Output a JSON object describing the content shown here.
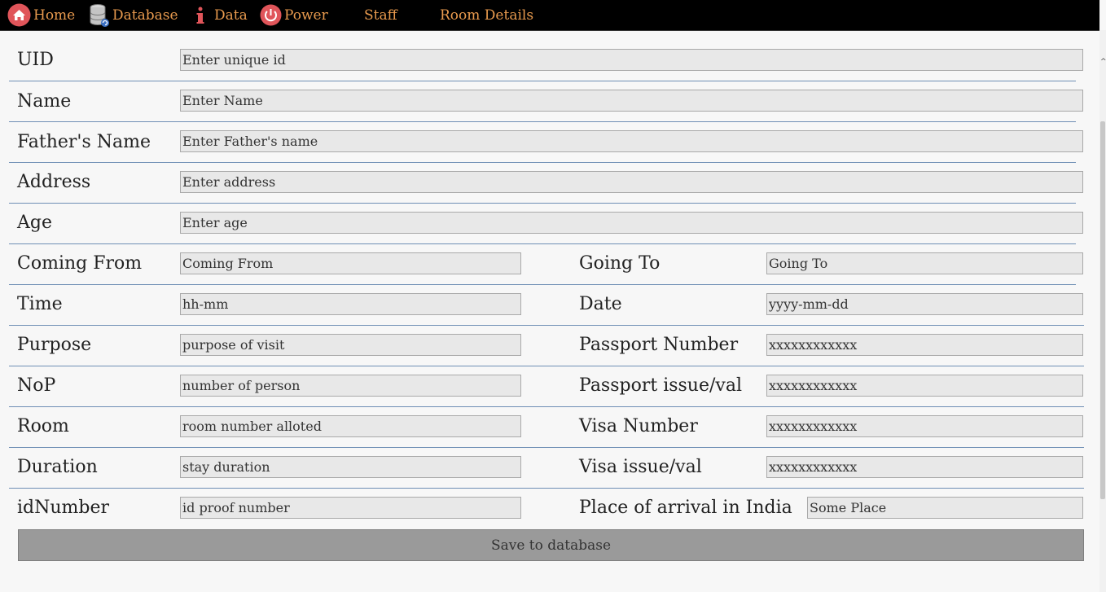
{
  "nav": {
    "home": "Home",
    "database": "Database",
    "data": "Data",
    "power": "Power",
    "staff": "Staff",
    "room_details": "Room Details"
  },
  "form": {
    "uid": {
      "label": "UID",
      "placeholder": "Enter unique id"
    },
    "name": {
      "label": "Name",
      "placeholder": "Enter Name"
    },
    "father_name": {
      "label": "Father's Name",
      "placeholder": "Enter Father's name"
    },
    "address": {
      "label": "Address",
      "placeholder": "Enter address"
    },
    "age": {
      "label": "Age",
      "placeholder": "Enter age"
    },
    "coming_from": {
      "label": "Coming From",
      "placeholder": "Coming From"
    },
    "going_to": {
      "label": "Going To",
      "placeholder": "Going To"
    },
    "time": {
      "label": "Time",
      "placeholder": "hh-mm"
    },
    "date": {
      "label": "Date",
      "placeholder": "yyyy-mm-dd"
    },
    "purpose": {
      "label": "Purpose",
      "placeholder": "purpose of visit"
    },
    "passport_number": {
      "label": "Passport Number",
      "placeholder": "xxxxxxxxxxxx"
    },
    "nop": {
      "label": "NoP",
      "placeholder": "number of person"
    },
    "passport_issue": {
      "label": "Passport issue/val",
      "placeholder": "xxxxxxxxxxxx"
    },
    "room": {
      "label": "Room",
      "placeholder": "room number alloted"
    },
    "visa_number": {
      "label": "Visa Number",
      "placeholder": "xxxxxxxxxxxx"
    },
    "duration": {
      "label": "Duration",
      "placeholder": "stay duration"
    },
    "visa_issue": {
      "label": "Visa issue/val",
      "placeholder": "xxxxxxxxxxxx"
    },
    "id_number": {
      "label": "idNumber",
      "placeholder": "id proof number"
    },
    "place_of_arrival": {
      "label": "Place of arrival in India",
      "placeholder": "Some Place"
    }
  },
  "save_label": "Save to database",
  "colors": {
    "nav_bg": "#000000",
    "nav_text": "#e89a4e",
    "accent_icon": "#e0555a",
    "divider": "#6f8fb5"
  }
}
